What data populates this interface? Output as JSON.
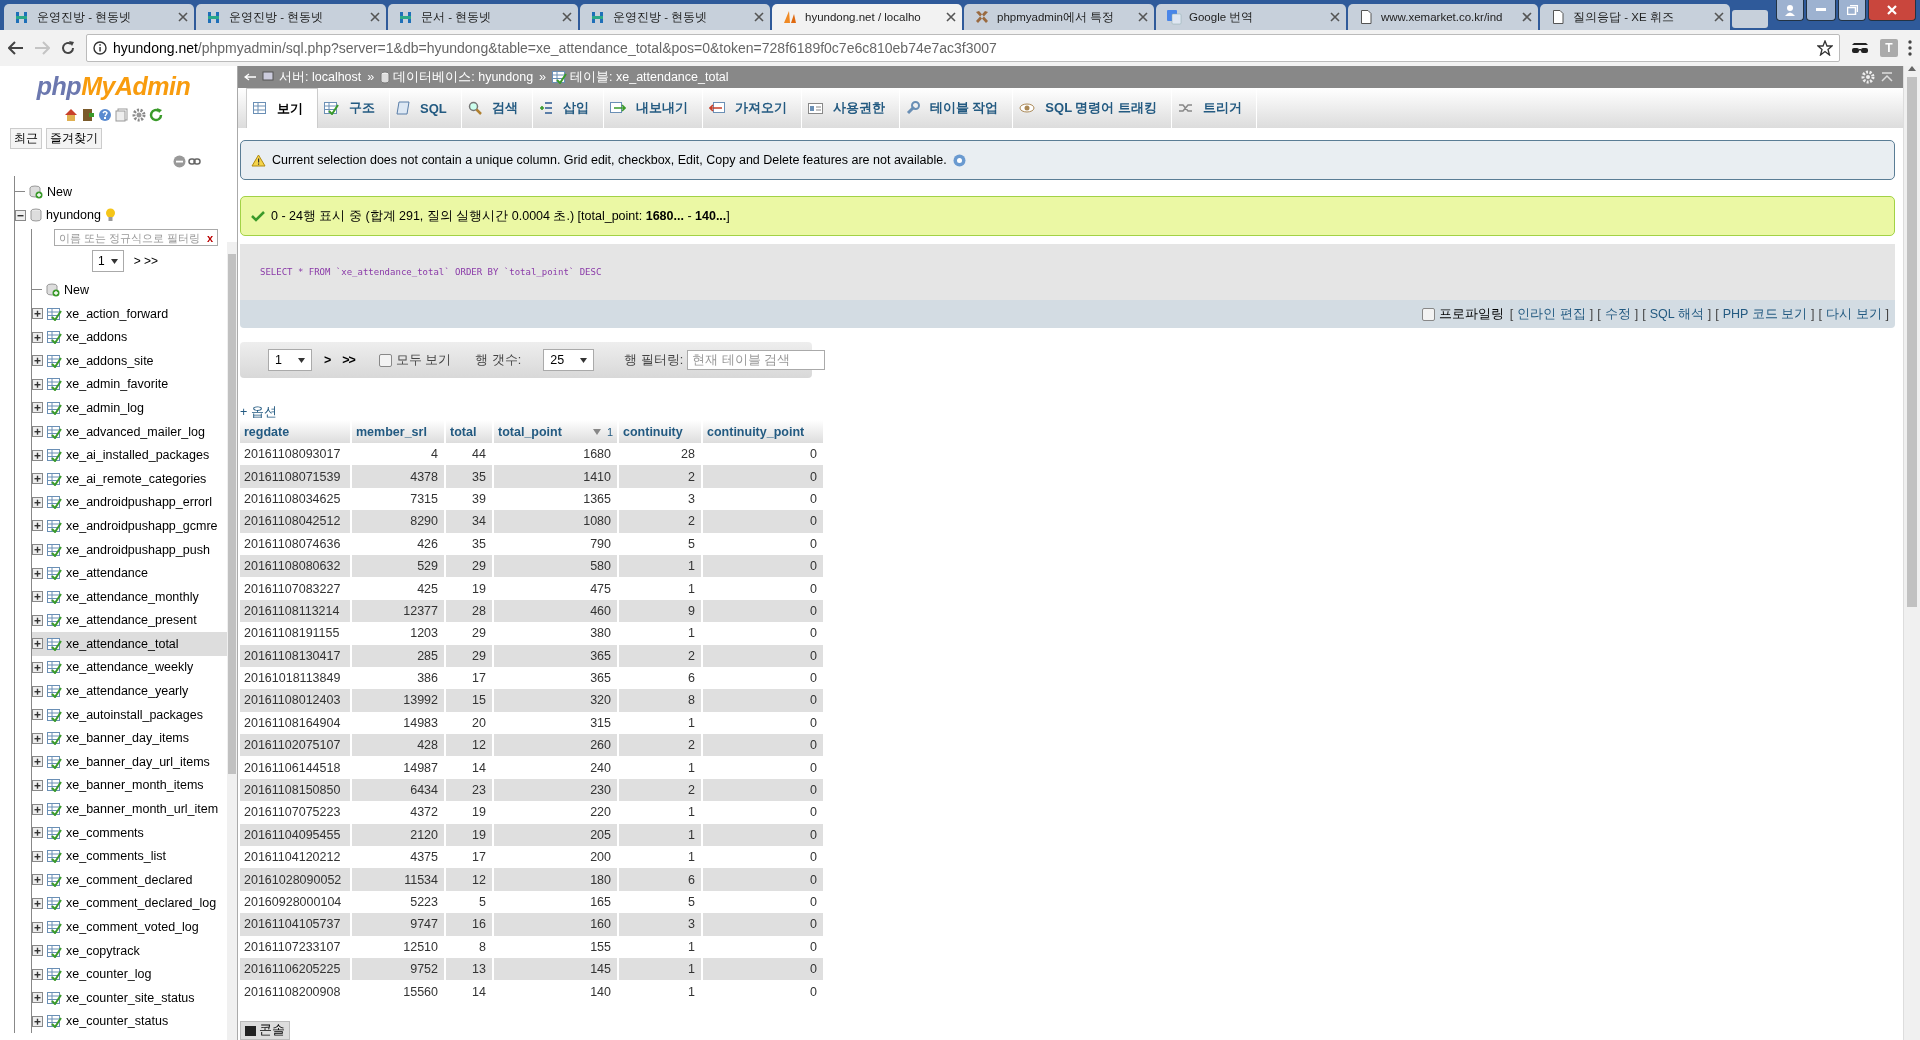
{
  "browser": {
    "tabs": [
      {
        "title": "운영진방 - 현동넷",
        "kind": "site",
        "selected": false
      },
      {
        "title": "운영진방 - 현동넷",
        "kind": "site",
        "selected": false
      },
      {
        "title": "문서 - 현동넷",
        "kind": "site",
        "selected": false
      },
      {
        "title": "운영진방 - 현동넷",
        "kind": "site",
        "selected": false
      },
      {
        "title": "hyundong.net / localho",
        "kind": "sail",
        "selected": true
      },
      {
        "title": "phpmyadmin에서 특정",
        "kind": "cross",
        "selected": false
      },
      {
        "title": "Google 번역",
        "kind": "translate",
        "selected": false
      },
      {
        "title": "www.xemarket.co.kr/ind",
        "kind": "page",
        "selected": false
      },
      {
        "title": "질의응답 - XE 휘즈",
        "kind": "page",
        "selected": false
      }
    ],
    "address": {
      "host": "hyundong.net",
      "path": "/phpmyadmin/sql.php?server=1&db=hyundong&table=xe_attendance_total&pos=0&token=728f6189f0c7e6c810eb74e7ac3f3007"
    },
    "forward_disabled": true,
    "extensions": [
      {
        "kind": "glasses"
      },
      {
        "kind": "letter",
        "label": "T"
      }
    ]
  },
  "sidebar": {
    "logo_prefix": "php",
    "logo_name": "MyAdmin",
    "recent_button": "최근",
    "favorites_button": "즐겨찾기",
    "tree": [
      {
        "label": "New",
        "kind": "new"
      },
      {
        "label": "hyundong",
        "kind": "database",
        "expanded": true,
        "filter_placeholder": "이름 또는 정규식으로 필터링",
        "clear_filter": "x",
        "page": "1",
        "page_nav": "> >>",
        "children": [
          {
            "label": "New",
            "kind": "new"
          },
          {
            "label": "xe_action_forward",
            "kind": "table",
            "expanded": false,
            "selected": false
          },
          {
            "label": "xe_addons",
            "kind": "table",
            "expanded": false,
            "selected": false
          },
          {
            "label": "xe_addons_site",
            "kind": "table",
            "expanded": false,
            "selected": false
          },
          {
            "label": "xe_admin_favorite",
            "kind": "table",
            "expanded": false,
            "selected": false
          },
          {
            "label": "xe_admin_log",
            "kind": "table",
            "expanded": false,
            "selected": false
          },
          {
            "label": "xe_advanced_mailer_log",
            "kind": "table",
            "expanded": false,
            "selected": false
          },
          {
            "label": "xe_ai_installed_packages",
            "kind": "table",
            "expanded": false,
            "selected": false
          },
          {
            "label": "xe_ai_remote_categories",
            "kind": "table",
            "expanded": false,
            "selected": false
          },
          {
            "label": "xe_androidpushapp_errorl",
            "kind": "table",
            "expanded": false,
            "selected": false
          },
          {
            "label": "xe_androidpushapp_gcmre",
            "kind": "table",
            "expanded": false,
            "selected": false
          },
          {
            "label": "xe_androidpushapp_push",
            "kind": "table",
            "expanded": false,
            "selected": false
          },
          {
            "label": "xe_attendance",
            "kind": "table",
            "expanded": false,
            "selected": false
          },
          {
            "label": "xe_attendance_monthly",
            "kind": "table",
            "expanded": false,
            "selected": false
          },
          {
            "label": "xe_attendance_present",
            "kind": "table",
            "expanded": false,
            "selected": false
          },
          {
            "label": "xe_attendance_total",
            "kind": "table",
            "expanded": false,
            "selected": true
          },
          {
            "label": "xe_attendance_weekly",
            "kind": "table",
            "expanded": false,
            "selected": false
          },
          {
            "label": "xe_attendance_yearly",
            "kind": "table",
            "expanded": false,
            "selected": false
          },
          {
            "label": "xe_autoinstall_packages",
            "kind": "table",
            "expanded": false,
            "selected": false
          },
          {
            "label": "xe_banner_day_items",
            "kind": "table",
            "expanded": false,
            "selected": false
          },
          {
            "label": "xe_banner_day_url_items",
            "kind": "table",
            "expanded": false,
            "selected": false
          },
          {
            "label": "xe_banner_month_items",
            "kind": "table",
            "expanded": false,
            "selected": false
          },
          {
            "label": "xe_banner_month_url_item",
            "kind": "table",
            "expanded": false,
            "selected": false
          },
          {
            "label": "xe_comments",
            "kind": "table",
            "expanded": false,
            "selected": false
          },
          {
            "label": "xe_comments_list",
            "kind": "table",
            "expanded": false,
            "selected": false
          },
          {
            "label": "xe_comment_declared",
            "kind": "table",
            "expanded": false,
            "selected": false
          },
          {
            "label": "xe_comment_declared_log",
            "kind": "table",
            "expanded": false,
            "selected": false
          },
          {
            "label": "xe_comment_voted_log",
            "kind": "table",
            "expanded": false,
            "selected": false
          },
          {
            "label": "xe_copytrack",
            "kind": "table",
            "expanded": false,
            "selected": false
          },
          {
            "label": "xe_counter_log",
            "kind": "table",
            "expanded": false,
            "selected": false
          },
          {
            "label": "xe_counter_site_status",
            "kind": "table",
            "expanded": false,
            "selected": false
          },
          {
            "label": "xe_counter_status",
            "kind": "table",
            "expanded": false,
            "selected": false
          }
        ]
      }
    ]
  },
  "breadcrumb": {
    "separator": "»",
    "items": [
      {
        "label": "서버: localhost",
        "kind": "server"
      },
      {
        "label": "데이터베이스: hyundong",
        "kind": "database"
      },
      {
        "label": "테이블: xe_attendance_total",
        "kind": "table"
      }
    ]
  },
  "tabs": [
    {
      "label": "보기",
      "kind": "browse",
      "selected": true
    },
    {
      "label": "구조",
      "kind": "structure",
      "selected": false
    },
    {
      "label": "SQL",
      "kind": "sql",
      "selected": false
    },
    {
      "label": "검색",
      "kind": "search",
      "selected": false
    },
    {
      "label": "삽입",
      "kind": "insert",
      "selected": false
    },
    {
      "label": "내보내기",
      "kind": "export",
      "selected": false
    },
    {
      "label": "가져오기",
      "kind": "import",
      "selected": false
    },
    {
      "label": "사용권한",
      "kind": "privileges",
      "selected": false
    },
    {
      "label": "테이블 작업",
      "kind": "operations",
      "selected": false
    },
    {
      "label": "SQL 명령어 트래킹",
      "kind": "tracking",
      "selected": false
    },
    {
      "label": "트리거",
      "kind": "triggers",
      "selected": false
    }
  ],
  "notice": "Current selection does not contain a unique column. Grid edit, checkbox, Edit, Copy and Delete features are not available.",
  "success": "0 - 24행 표시 중 (합계 291, 질의 실행시간 0.0004 초.) [total_point: **1680...** - **140...**]",
  "query": {
    "sql": "SELECT * FROM `xe_attendance_total` ORDER BY `total_point` DESC",
    "profiling": {
      "label": "프로파일링",
      "checked": false
    },
    "bracket_open": "[",
    "bracket_close": "]",
    "links": [
      "인라인 편집",
      "수정",
      "SQL 해석",
      "PHP 코드 보기",
      "다시 보기"
    ]
  },
  "navigation": {
    "page": "1",
    "next": ">",
    "last": ">>",
    "show_all": {
      "label": "모두 보기",
      "checked": false
    },
    "rows_label": "행 갯수:",
    "rows_value": "25",
    "filter_label": "행 필터링:",
    "filter_placeholder": "현재 테이블 검색"
  },
  "options_link": "+ 옵션",
  "table": {
    "columns": [
      {
        "label": "regdate",
        "kind": "text",
        "sorted": false
      },
      {
        "label": "member_srl",
        "kind": "number",
        "sorted": false
      },
      {
        "label": "total",
        "kind": "number",
        "sorted": false
      },
      {
        "label": "total_point",
        "kind": "number",
        "sorted": true,
        "sort_order": "1"
      },
      {
        "label": "continuity",
        "kind": "number",
        "sorted": false
      },
      {
        "label": "continuity_point",
        "kind": "number",
        "sorted": false
      }
    ],
    "rows": [
      [
        "20161108093017",
        "4",
        "44",
        "1680",
        "28",
        "0"
      ],
      [
        "20161108071539",
        "4378",
        "35",
        "1410",
        "2",
        "0"
      ],
      [
        "20161108034625",
        "7315",
        "39",
        "1365",
        "3",
        "0"
      ],
      [
        "20161108042512",
        "8290",
        "34",
        "1080",
        "2",
        "0"
      ],
      [
        "20161108074636",
        "426",
        "35",
        "790",
        "5",
        "0"
      ],
      [
        "20161108080632",
        "529",
        "29",
        "580",
        "1",
        "0"
      ],
      [
        "20161107083227",
        "425",
        "19",
        "475",
        "1",
        "0"
      ],
      [
        "20161108113214",
        "12377",
        "28",
        "460",
        "9",
        "0"
      ],
      [
        "20161108191155",
        "1203",
        "29",
        "380",
        "1",
        "0"
      ],
      [
        "20161108130417",
        "285",
        "29",
        "365",
        "2",
        "0"
      ],
      [
        "20161018113849",
        "386",
        "17",
        "365",
        "6",
        "0"
      ],
      [
        "20161108012403",
        "13992",
        "15",
        "320",
        "8",
        "0"
      ],
      [
        "20161108164904",
        "14983",
        "20",
        "315",
        "1",
        "0"
      ],
      [
        "20161102075107",
        "428",
        "12",
        "260",
        "2",
        "0"
      ],
      [
        "20161106144518",
        "14987",
        "14",
        "240",
        "1",
        "0"
      ],
      [
        "20161108150850",
        "6434",
        "23",
        "230",
        "2",
        "0"
      ],
      [
        "20161107075223",
        "4372",
        "19",
        "220",
        "1",
        "0"
      ],
      [
        "20161104095455",
        "2120",
        "19",
        "205",
        "1",
        "0"
      ],
      [
        "20161104120212",
        "4375",
        "17",
        "200",
        "1",
        "0"
      ],
      [
        "20161028090052",
        "11534",
        "12",
        "180",
        "6",
        "0"
      ],
      [
        "20160928000104",
        "5223",
        "5",
        "165",
        "5",
        "0"
      ],
      [
        "20161104105737",
        "9747",
        "16",
        "160",
        "3",
        "0"
      ],
      [
        "20161107233107",
        "12510",
        "8",
        "155",
        "1",
        "0"
      ],
      [
        "20161106205225",
        "9752",
        "13",
        "145",
        "1",
        "0"
      ],
      [
        "20161108200908",
        "15560",
        "14",
        "140",
        "1",
        "0"
      ]
    ]
  },
  "console_button": "콘솔"
}
